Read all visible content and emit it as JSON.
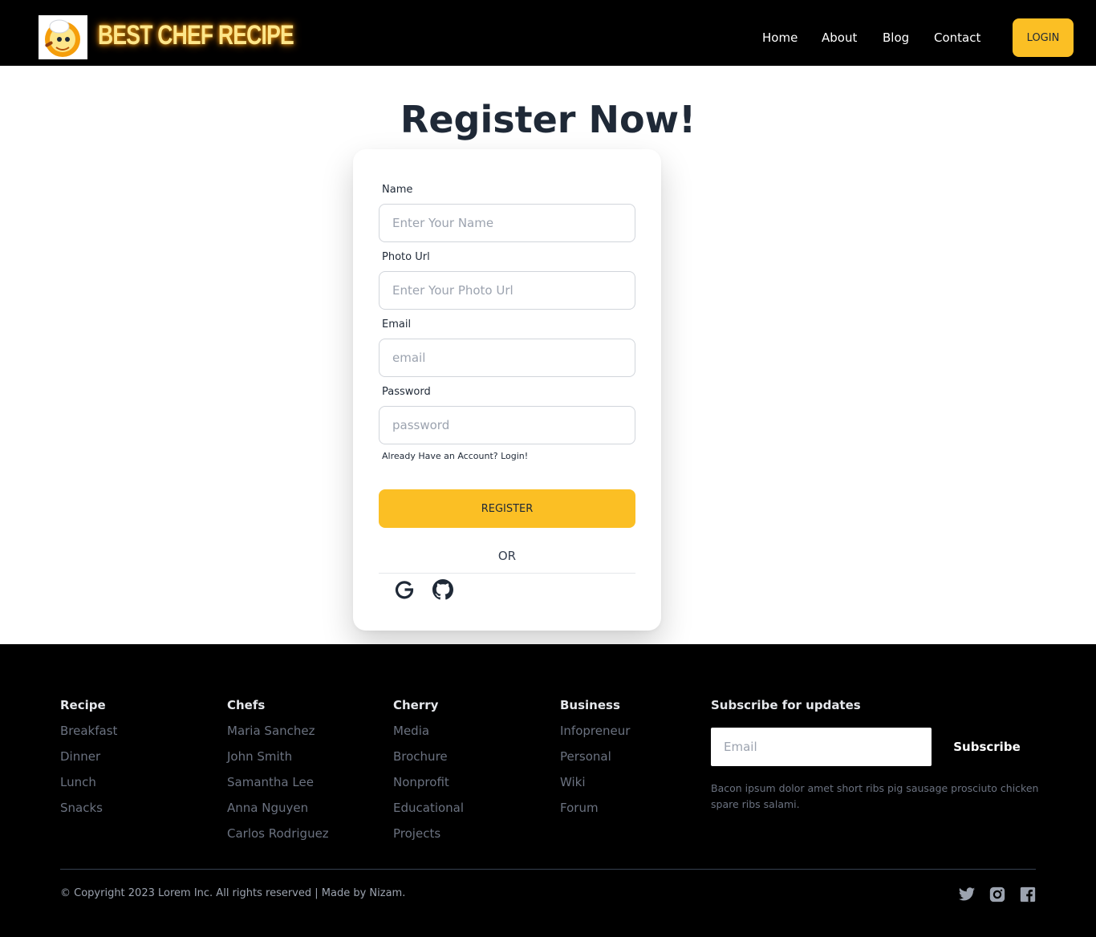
{
  "header": {
    "brand": "BEST CHEF RECIPE",
    "nav": [
      "Home",
      "About",
      "Blog",
      "Contact"
    ],
    "login_label": "LOGIN",
    "accent": "#fbbf24"
  },
  "main": {
    "title": "Register Now!",
    "fields": [
      {
        "label": "Name",
        "placeholder": "Enter Your Name"
      },
      {
        "label": "Photo Url",
        "placeholder": "Enter Your Photo Url"
      },
      {
        "label": "Email",
        "placeholder": "email"
      },
      {
        "label": "Password",
        "placeholder": "password"
      }
    ],
    "login_link": "Already Have an Account? Login!",
    "register_label": "REGISTER",
    "or_text": "OR",
    "social_icons": [
      "google-icon",
      "github-icon"
    ]
  },
  "footer": {
    "columns": [
      {
        "heading": "Recipe",
        "items": [
          "Breakfast",
          "Dinner",
          "Lunch",
          "Snacks"
        ]
      },
      {
        "heading": "Chefs",
        "items": [
          "Maria Sanchez",
          "John Smith",
          "Samantha Lee",
          "Anna Nguyen",
          "Carlos Rodriguez"
        ]
      },
      {
        "heading": "Cherry",
        "items": [
          "Media",
          "Brochure",
          "Nonprofit",
          "Educational",
          "Projects"
        ]
      },
      {
        "heading": "Business",
        "items": [
          "Infopreneur",
          "Personal",
          "Wiki",
          "Forum"
        ]
      }
    ],
    "subscribe": {
      "heading": "Subscribe for updates",
      "placeholder": "Email",
      "button": "Subscribe",
      "text": "Bacon ipsum dolor amet short ribs pig sausage prosciuto chicken spare ribs salami."
    },
    "copyright": "© Copyright 2023 Lorem Inc. All rights reserved | Made by Nizam.",
    "social_icons": [
      "twitter-icon",
      "instagram-icon",
      "facebook-icon"
    ]
  }
}
